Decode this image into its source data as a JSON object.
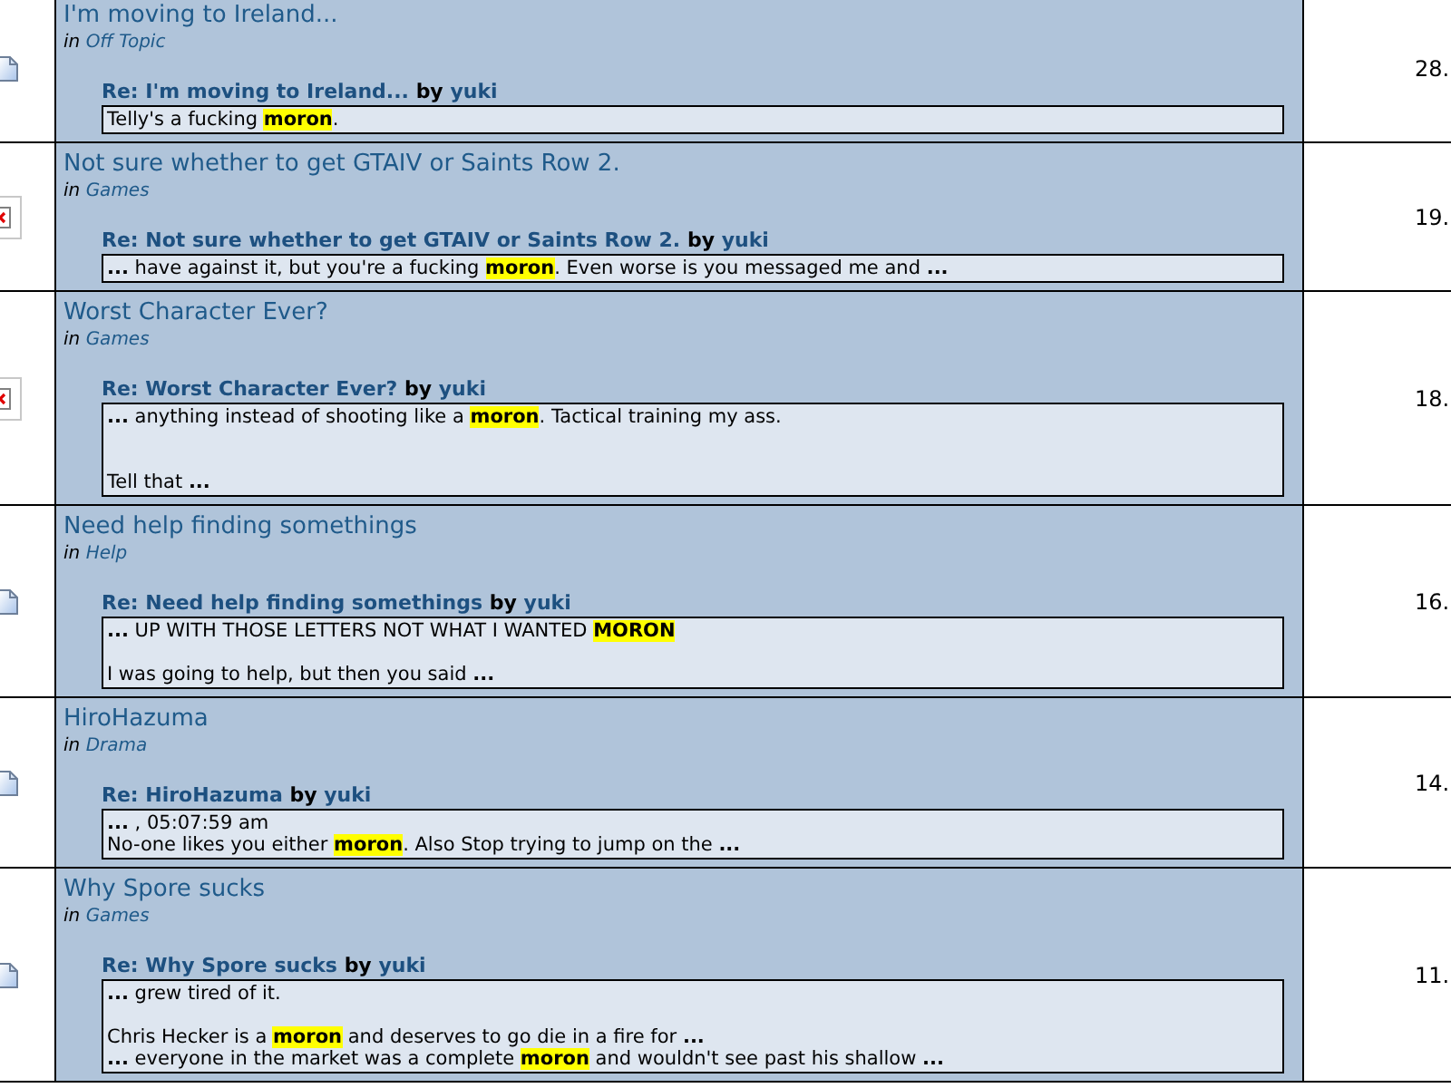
{
  "results": [
    {
      "image_loaded": true,
      "title": "I'm moving to Ireland...",
      "in_label": "in",
      "category": "Off Topic",
      "reply_title": "Re: I'm moving to Ireland...",
      "by_label": "by",
      "author": "yuki",
      "number": "28.",
      "lines": [
        {
          "kind": "text",
          "segments": [
            {
              "kind": "plain",
              "text": "Telly's a fucking "
            },
            {
              "kind": "match",
              "text": "moron"
            },
            {
              "kind": "plain",
              "text": "."
            }
          ]
        }
      ]
    },
    {
      "image_loaded": false,
      "title": "Not sure whether to get GTAIV or Saints Row 2.",
      "in_label": "in",
      "category": "Games",
      "reply_title": "Re: Not sure whether to get GTAIV or Saints Row 2.",
      "by_label": "by",
      "author": "yuki",
      "number": "19.",
      "lines": [
        {
          "kind": "text",
          "segments": [
            {
              "kind": "ellipsis",
              "text": "..."
            },
            {
              "kind": "plain",
              "text": "  have against it, but you're a fucking "
            },
            {
              "kind": "match",
              "text": "moron"
            },
            {
              "kind": "plain",
              "text": ". Even worse is you messaged me and  "
            },
            {
              "kind": "ellipsis",
              "text": "..."
            }
          ]
        }
      ]
    },
    {
      "image_loaded": false,
      "title": "Worst Character Ever?",
      "in_label": "in",
      "category": "Games",
      "reply_title": "Re: Worst Character Ever?",
      "by_label": "by",
      "author": "yuki",
      "number": "18.",
      "lines": [
        {
          "kind": "text",
          "segments": [
            {
              "kind": "ellipsis",
              "text": "..."
            },
            {
              "kind": "plain",
              "text": "  anything instead of shooting like a "
            },
            {
              "kind": "match",
              "text": "moron"
            },
            {
              "kind": "plain",
              "text": ". Tactical training my ass."
            }
          ]
        },
        {
          "kind": "blank"
        },
        {
          "kind": "blank"
        },
        {
          "kind": "text",
          "segments": [
            {
              "kind": "plain",
              "text": "Tell that  "
            },
            {
              "kind": "ellipsis",
              "text": "..."
            }
          ]
        }
      ]
    },
    {
      "image_loaded": true,
      "title": "Need help finding somethings",
      "in_label": "in",
      "category": "Help",
      "reply_title": "Re: Need help finding somethings",
      "by_label": "by",
      "author": "yuki",
      "number": "16.",
      "lines": [
        {
          "kind": "text",
          "segments": [
            {
              "kind": "ellipsis",
              "text": "..."
            },
            {
              "kind": "plain",
              "text": "  UP WITH THOSE LETTERS NOT WHAT I WANTED "
            },
            {
              "kind": "match",
              "text": "MORON"
            }
          ]
        },
        {
          "kind": "blank"
        },
        {
          "kind": "text",
          "segments": [
            {
              "kind": "plain",
              "text": "I was going to help, but then you said  "
            },
            {
              "kind": "ellipsis",
              "text": "..."
            }
          ]
        }
      ]
    },
    {
      "image_loaded": true,
      "title": "HiroHazuma",
      "in_label": "in",
      "category": "Drama",
      "reply_title": "Re: HiroHazuma",
      "by_label": "by",
      "author": "yuki",
      "number": "14.",
      "lines": [
        {
          "kind": "text",
          "segments": [
            {
              "kind": "ellipsis",
              "text": "..."
            },
            {
              "kind": "plain",
              "text": " , 05:07:59 am"
            }
          ]
        },
        {
          "kind": "text",
          "segments": [
            {
              "kind": "plain",
              "text": "No-one likes you either "
            },
            {
              "kind": "match",
              "text": "moron"
            },
            {
              "kind": "plain",
              "text": ". Also Stop trying to jump on the  "
            },
            {
              "kind": "ellipsis",
              "text": "..."
            }
          ]
        }
      ]
    },
    {
      "image_loaded": true,
      "title": "Why Spore sucks",
      "in_label": "in",
      "category": "Games",
      "reply_title": "Re: Why Spore sucks",
      "by_label": "by",
      "author": "yuki",
      "number": "11.",
      "lines": [
        {
          "kind": "text",
          "segments": [
            {
              "kind": "ellipsis",
              "text": "..."
            },
            {
              "kind": "plain",
              "text": "  grew tired of it."
            }
          ]
        },
        {
          "kind": "blank"
        },
        {
          "kind": "text",
          "segments": [
            {
              "kind": "plain",
              "text": "Chris Hecker is a "
            },
            {
              "kind": "match",
              "text": "moron"
            },
            {
              "kind": "plain",
              "text": " and deserves to go die in a fire for  "
            },
            {
              "kind": "ellipsis",
              "text": "..."
            }
          ]
        },
        {
          "kind": "text",
          "segments": [
            {
              "kind": "ellipsis",
              "text": "..."
            },
            {
              "kind": "plain",
              "text": "  everyone in the market was a complete "
            },
            {
              "kind": "match",
              "text": "moron"
            },
            {
              "kind": "plain",
              "text": " and wouldn't see past his shallow  "
            },
            {
              "kind": "ellipsis",
              "text": "..."
            }
          ]
        }
      ]
    }
  ]
}
